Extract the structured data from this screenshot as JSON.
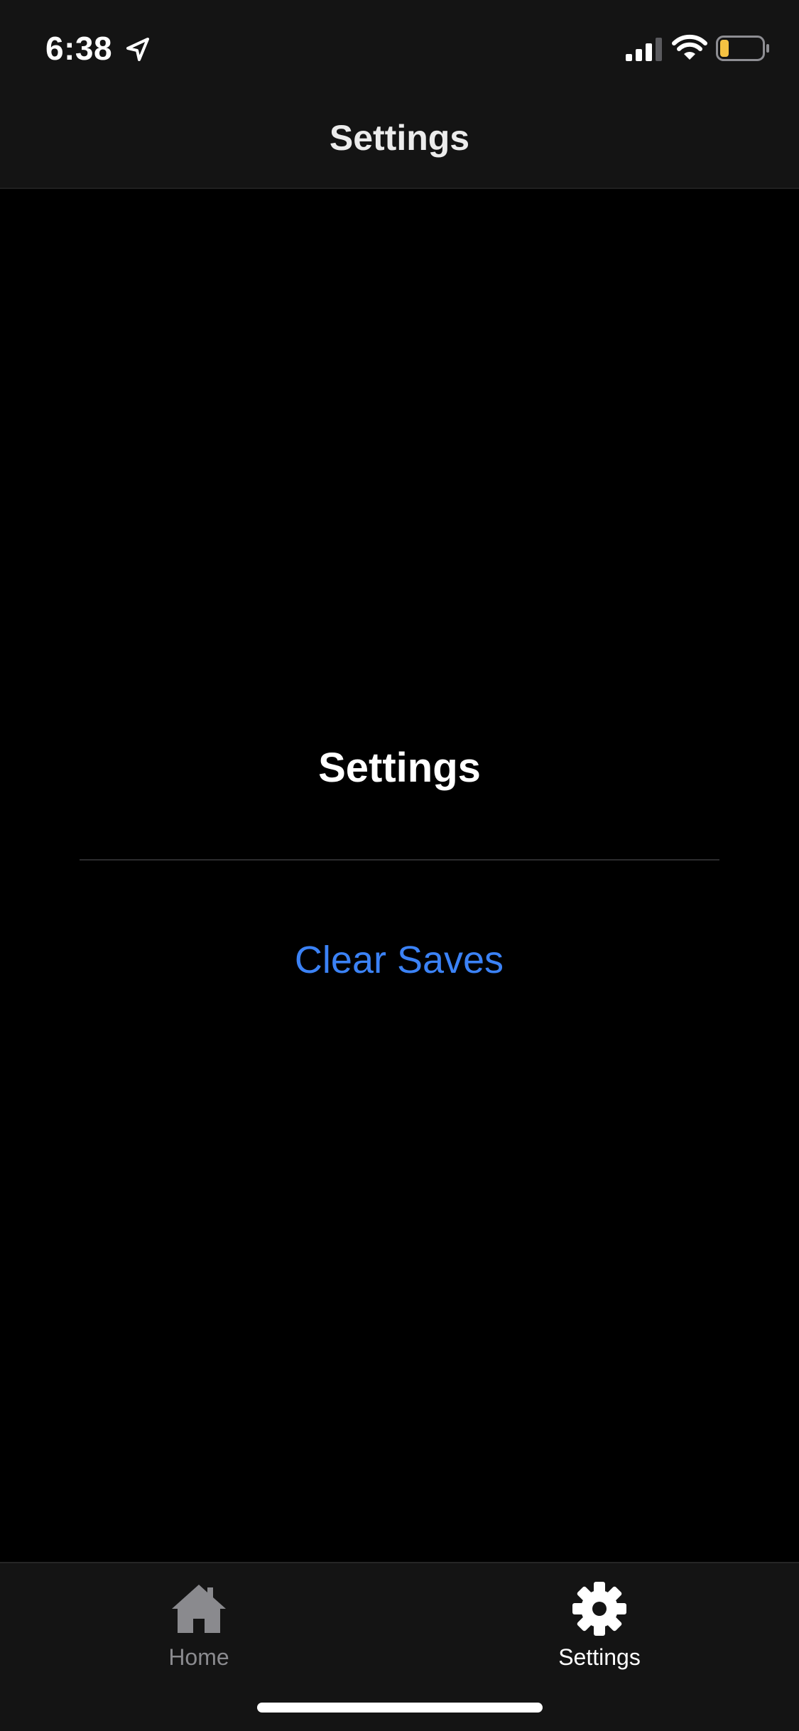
{
  "status_bar": {
    "time": "6:38",
    "icons": [
      "location-arrow-icon",
      "cellular-signal-icon",
      "wifi-icon",
      "battery-low-icon"
    ],
    "battery_color": "#f5c242"
  },
  "nav": {
    "title": "Settings"
  },
  "main": {
    "heading": "Settings",
    "clear_saves_label": "Clear Saves",
    "link_color": "#3b82f6"
  },
  "tab_bar": {
    "tabs": [
      {
        "label": "Home",
        "icon": "home-icon",
        "active": false
      },
      {
        "label": "Settings",
        "icon": "gear-icon",
        "active": true
      }
    ]
  }
}
